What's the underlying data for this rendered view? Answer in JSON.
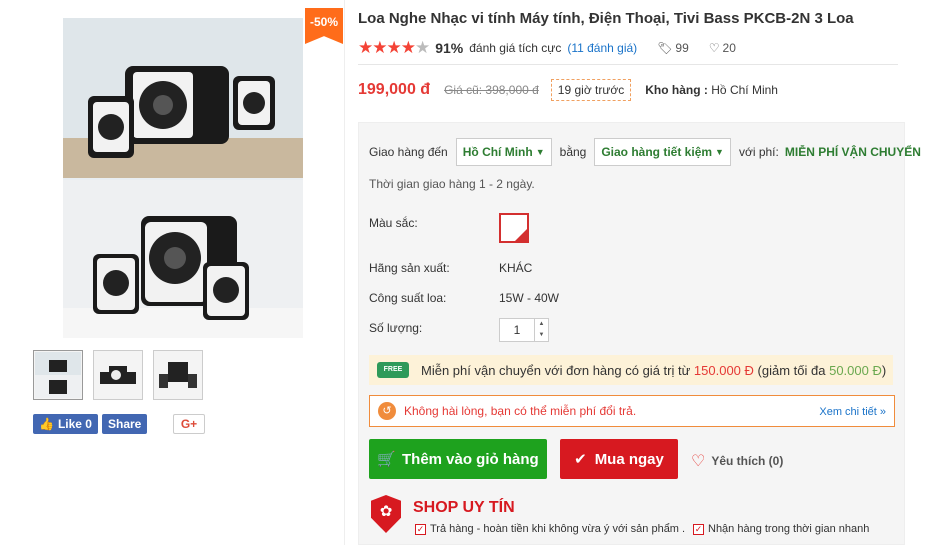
{
  "product": {
    "discount_badge": "-50%",
    "title": "Loa Nghe Nhạc vi tính Máy tính, Điện Thoại, Tivi Bass PKCB-2N 3 Loa",
    "rating_percent": "91%",
    "rating_text": "đánh giá tích cực",
    "rating_count": "(11 đánh giá)",
    "tag_count": "99",
    "like_count": "20",
    "price": "199,000 đ",
    "old_price": "Giá cũ: 398,000 đ",
    "posted_time": "19 giờ trước",
    "stock_label": "Kho hàng :",
    "stock_value": "Hồ Chí Minh"
  },
  "social": {
    "fb_like": "Like 0",
    "fb_share": "Share",
    "gplus": "G+"
  },
  "shipping": {
    "to_label": "Giao hàng đến",
    "to_value": "Hồ Chí Minh",
    "by_label": "bằng",
    "method": "Giao hàng tiết kiệm",
    "fee_label": "với phí:",
    "fee_value": "MIỄN PHÍ VẬN CHUYỂN",
    "time": "Thời gian giao hàng 1 - 2 ngày."
  },
  "attributes": {
    "color_label": "Màu sắc:",
    "brand_label": "Hãng sản xuất:",
    "brand_value": "KHÁC",
    "power_label": "Công suất loa:",
    "power_value": "15W - 40W",
    "qty_label": "Số lượng:",
    "qty_value": "1"
  },
  "promo": {
    "truck_text": "FREE",
    "text_a": "Miễn phí vận chuyển với đơn hàng có giá trị từ",
    "min_value": "150.000 Đ",
    "text_b": "(giảm tối đa",
    "max_value": "50.000 Đ",
    "text_c": ")"
  },
  "return_policy": {
    "text": "Không hài lòng, bạn có thể miễn phí đổi trả.",
    "link": "Xem chi tiết »"
  },
  "actions": {
    "add_cart": "Thêm vào giỏ hàng",
    "buy_now": "Mua ngay",
    "favorite": "Yêu thích (0)"
  },
  "trust": {
    "title": "SHOP UY TÍN",
    "item1": "Trả hàng - hoàn tiền khi không vừa ý với sản phẩm .",
    "item2": "Nhận hàng trong thời gian nhanh"
  },
  "colors": {
    "accent_red": "#e53935",
    "green": "#1ea21e",
    "orange": "#ff6c1a"
  }
}
